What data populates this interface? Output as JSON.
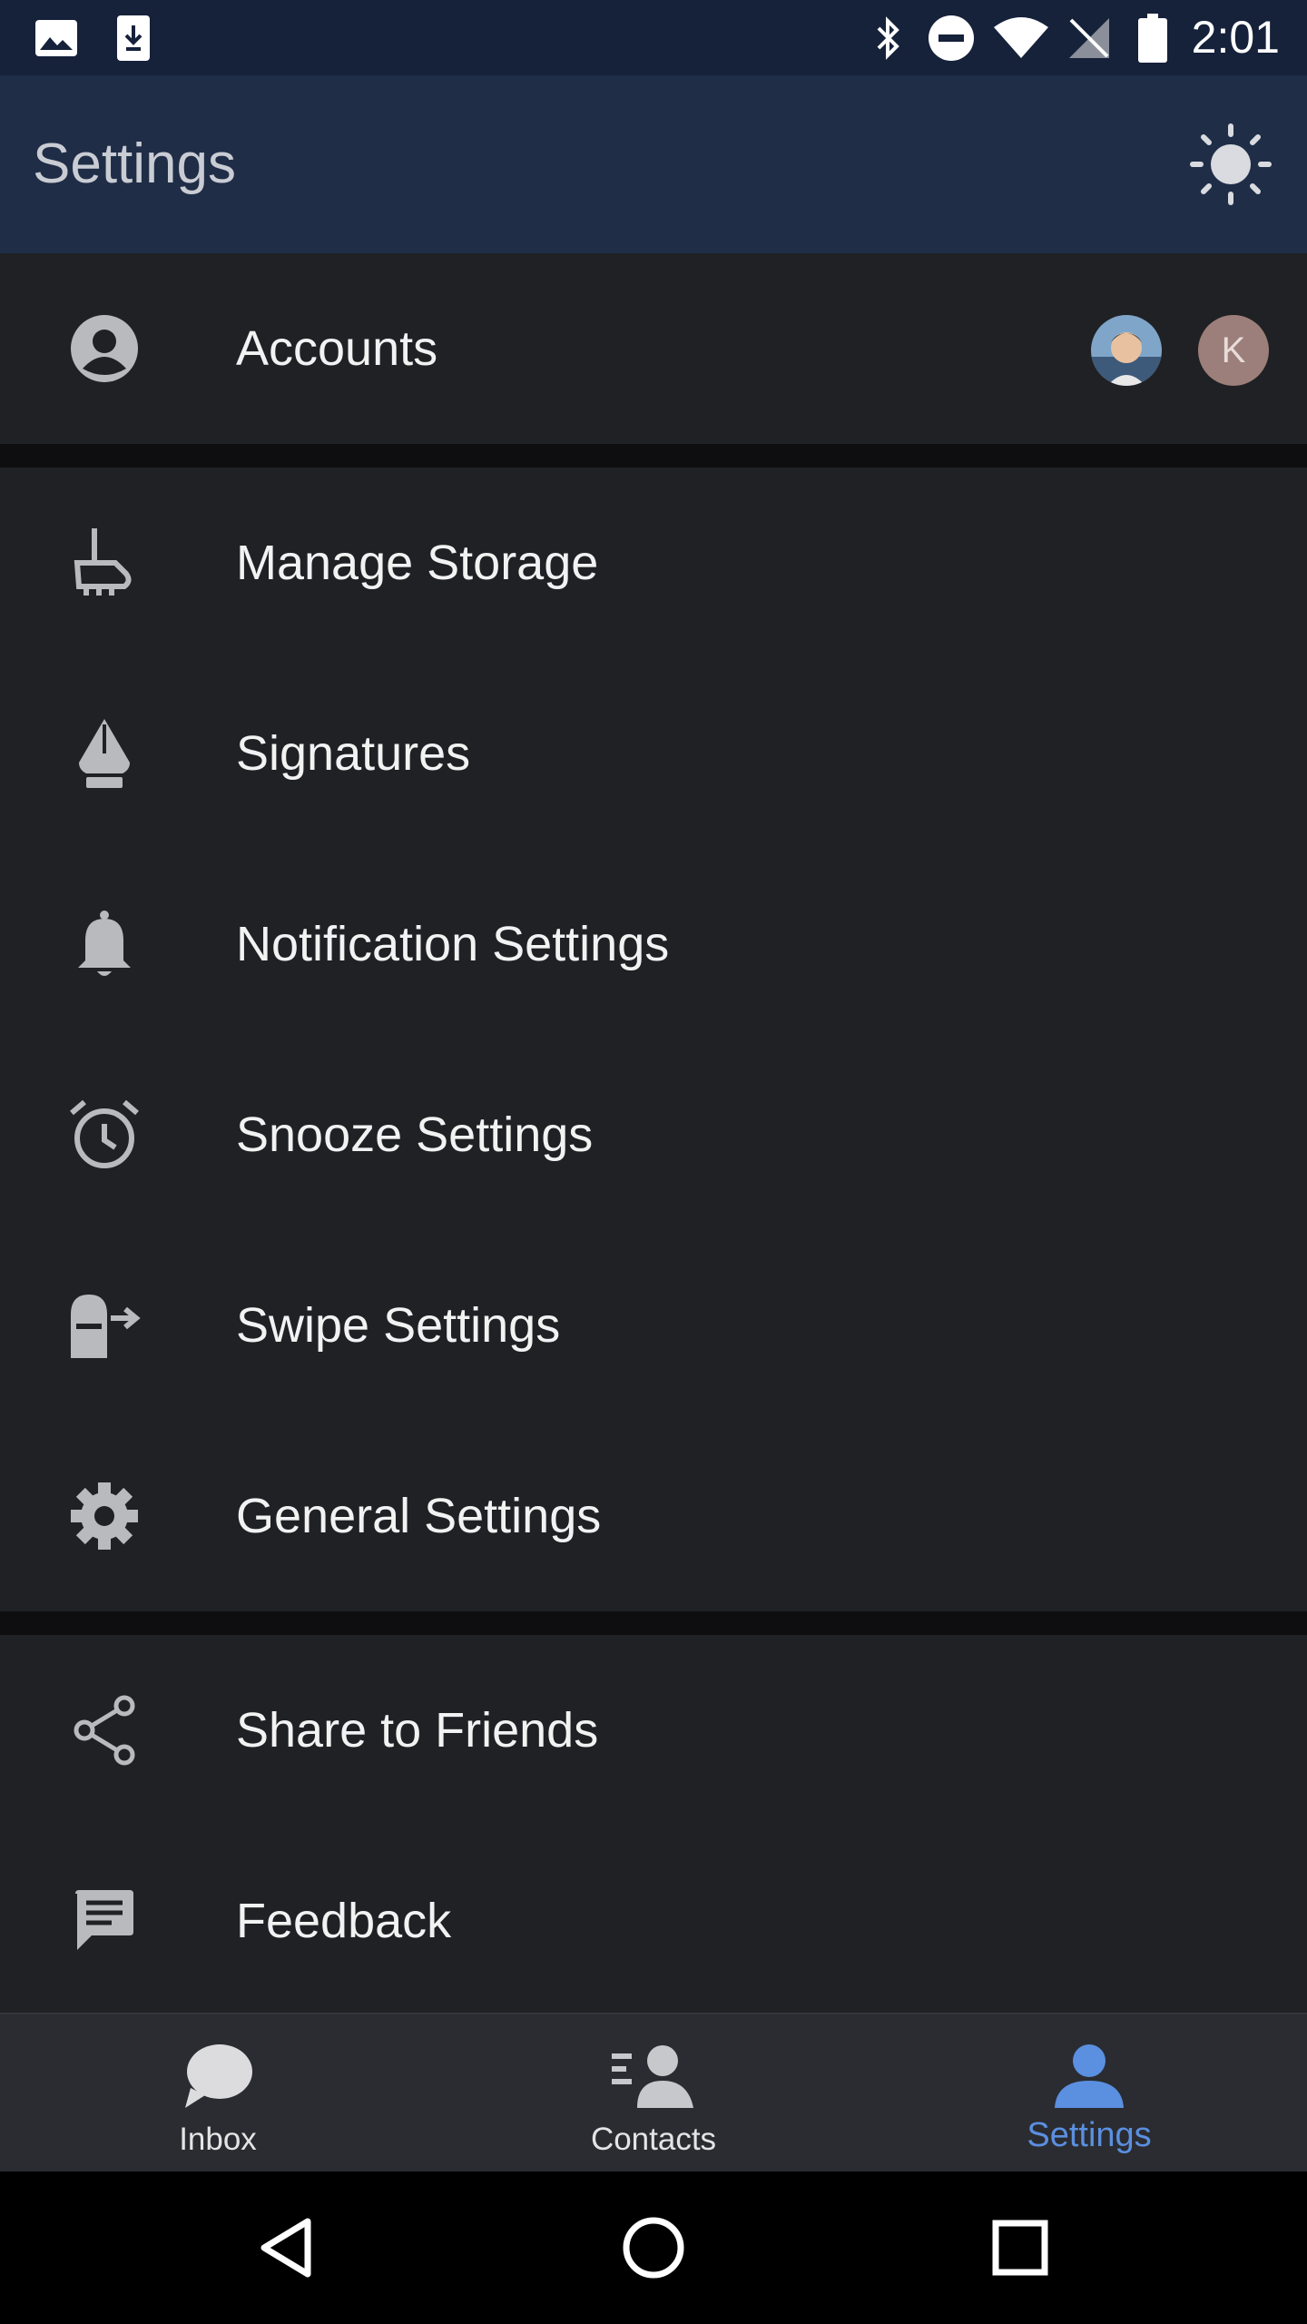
{
  "status_bar": {
    "time": "2:01",
    "icons": [
      "image-icon",
      "download-icon",
      "bluetooth-icon",
      "do-not-disturb-icon",
      "wifi-icon",
      "no-signal-icon",
      "battery-icon"
    ]
  },
  "app_bar": {
    "title": "Settings",
    "theme_icon": "sun-icon"
  },
  "accounts": {
    "label": "Accounts",
    "icon": "account-circle-icon",
    "avatar_letter": "K"
  },
  "items": [
    {
      "label": "Manage Storage",
      "icon": "broom-icon"
    },
    {
      "label": "Signatures",
      "icon": "pen-nib-icon"
    },
    {
      "label": "Notification Settings",
      "icon": "bell-icon"
    },
    {
      "label": "Snooze Settings",
      "icon": "alarm-clock-icon"
    },
    {
      "label": "Swipe Settings",
      "icon": "swipe-icon"
    },
    {
      "label": "General Settings",
      "icon": "gear-icon"
    }
  ],
  "extra_items": [
    {
      "label": "Share to Friends",
      "icon": "share-icon"
    },
    {
      "label": "Feedback",
      "icon": "feedback-icon"
    }
  ],
  "tabs": [
    {
      "label": "Inbox",
      "icon": "chat-bubble-icon",
      "active": false
    },
    {
      "label": "Contacts",
      "icon": "contacts-icon",
      "active": false
    },
    {
      "label": "Settings",
      "icon": "person-icon",
      "active": true
    }
  ],
  "colors": {
    "status_bar": "#16213a",
    "app_bar": "#1f2d47",
    "list_bg": "#202124",
    "accent": "#5b8fe0"
  }
}
